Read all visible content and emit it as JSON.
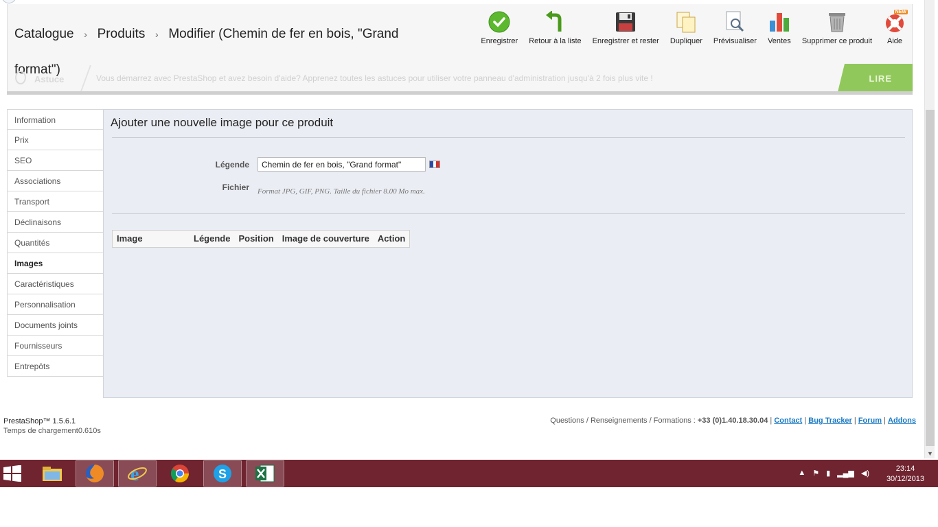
{
  "breadcrumb": {
    "items": [
      "Catalogue",
      "Produits",
      "Modifier (Chemin de fer en bois, \"Grand"
    ],
    "wrap_line": "format\")",
    "separator": "›"
  },
  "toolbar": {
    "buttons": [
      {
        "label": "Enregistrer",
        "icon": "check-circle-icon"
      },
      {
        "label": "Retour à la liste",
        "icon": "back-arrow-icon"
      },
      {
        "label": "Enregistrer et rester",
        "icon": "floppy-disk-icon"
      },
      {
        "label": "Dupliquer",
        "icon": "duplicate-icon"
      },
      {
        "label": "Prévisualiser",
        "icon": "preview-icon"
      },
      {
        "label": "Ventes",
        "icon": "bar-chart-icon"
      },
      {
        "label": "Supprimer ce produit",
        "icon": "trash-icon"
      },
      {
        "label": "Aide",
        "icon": "lifebuoy-icon"
      }
    ],
    "aide_badge": "NEW"
  },
  "astuce": {
    "label": "Astuce",
    "message": "Vous démarrez avec PrestaShop et avez besoin d'aide? Apprenez toutes les astuces pour utiliser votre panneau d'administration jusqu'à 2 fois plus vite !",
    "button": "LIRE"
  },
  "tabs": [
    {
      "label": "Information"
    },
    {
      "label": "Prix"
    },
    {
      "label": "SEO"
    },
    {
      "label": "Associations"
    },
    {
      "label": "Transport"
    },
    {
      "label": "Déclinaisons"
    },
    {
      "label": "Quantités"
    },
    {
      "label": "Images",
      "active": true
    },
    {
      "label": "Caractéristiques"
    },
    {
      "label": "Personnalisation"
    },
    {
      "label": "Documents joints"
    },
    {
      "label": "Fournisseurs"
    },
    {
      "label": "Entrepôts"
    }
  ],
  "panel": {
    "title": "Ajouter une nouvelle image pour ce produit",
    "legend_label": "Légende",
    "legend_value": "Chemin de fer en bois, \"Grand format\"",
    "file_label": "Fichier",
    "file_hint": "Format JPG, GIF, PNG. Taille du fichier 8.00 Mo max.",
    "table_headers": [
      "Image",
      "Légende",
      "Position",
      "Image de couverture",
      "Action"
    ]
  },
  "footer": {
    "version": "PrestaShop™ 1.5.6.1",
    "load_time": "Temps de chargement0.610s",
    "contact_prefix": "Questions / Renseignements / Formations :",
    "phone": "+33 (0)1.40.18.30.04",
    "links": [
      "Contact",
      "Bug Tracker",
      "Forum",
      "Addons"
    ]
  },
  "taskbar": {
    "apps": [
      "file-explorer-icon",
      "firefox-icon",
      "internet-explorer-icon",
      "chrome-icon",
      "skype-icon",
      "excel-icon"
    ],
    "time": "23:14",
    "date": "30/12/2013"
  },
  "colors": {
    "taskbar": "#6f2430",
    "panel_bg": "#ebedf4",
    "link": "#1a7ac4",
    "astuce_green": "#7fbf3f"
  }
}
